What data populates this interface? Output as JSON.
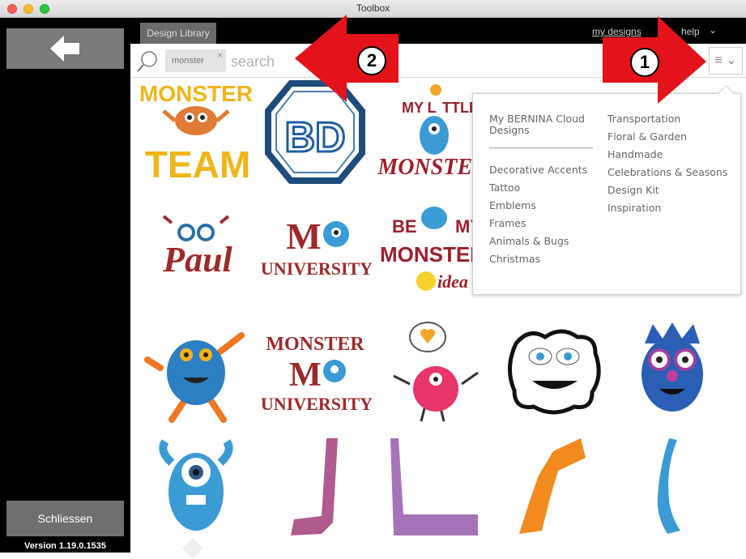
{
  "window": {
    "title": "Toolbox"
  },
  "sidebar": {
    "back_icon": "back-arrow-icon",
    "close_label": "Schliessen",
    "version": "Version 1.19.0.1535"
  },
  "topbar": {
    "tab_label": "Design Library",
    "links": {
      "my_designs": "my designs",
      "help": "help"
    }
  },
  "search": {
    "chip": "monster",
    "chip_remove": "×",
    "placeholder": "search",
    "menu_icon": "≡ ⌄"
  },
  "dropdown": {
    "col1_top": [
      "My BERNINA Cloud Designs"
    ],
    "col1_items": [
      "Decorative Accents",
      "Tattoo",
      "Emblems",
      "Frames",
      "Animals & Bugs",
      "Christmas"
    ],
    "col2_items": [
      "Transportation",
      "Floral & Garden",
      "Handmade",
      "Celebrations & Seasons",
      "Design Kit",
      "Inspiration"
    ]
  },
  "designs": {
    "monster_team": [
      "MONSTER",
      "TEAM"
    ],
    "monogram": "BD",
    "my_little_monster": [
      "MY L",
      "TTLE",
      "MONSTER"
    ],
    "paul": "Paul",
    "university": [
      "M",
      "UNIVERSITY"
    ],
    "be_my_monster": [
      "BE",
      "MY",
      "MONSTER",
      "idea"
    ],
    "monster_university": [
      "MONSTER",
      "M",
      "UNIVERSITY"
    ]
  },
  "annotations": {
    "one": "1",
    "two": "2"
  },
  "colors": {
    "red_arrow": "#e3121b",
    "sidebar": "#000000",
    "button_gray": "#7a7a7a"
  }
}
